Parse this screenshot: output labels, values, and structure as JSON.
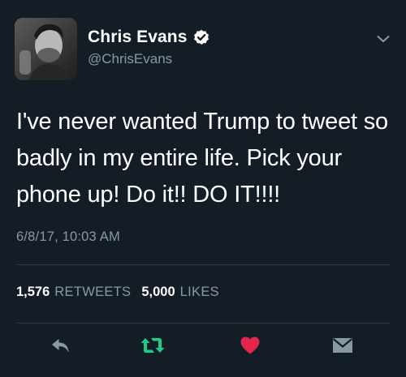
{
  "user": {
    "display_name": "Chris Evans",
    "handle": "@ChrisEvans",
    "verified": true
  },
  "tweet": {
    "text": "I've never wanted Trump to tweet so badly in my entire life. Pick your phone up! Do it!! DO IT!!!!",
    "timestamp": "6/8/17, 10:03 AM"
  },
  "stats": {
    "retweets_count": "1,576",
    "retweets_label": "RETWEETS",
    "likes_count": "5,000",
    "likes_label": "LIKES"
  },
  "icons": {
    "verified": "verified-check-icon",
    "menu": "chevron-down-icon",
    "reply": "reply-arrow-icon",
    "retweet": "retweet-icon",
    "like": "heart-icon",
    "dm": "envelope-icon"
  },
  "colors": {
    "background": "#141d26",
    "secondary_text": "#8899a6",
    "retweet_active": "#19cf86",
    "like_active": "#e2264d",
    "divider": "#2d3a46"
  }
}
